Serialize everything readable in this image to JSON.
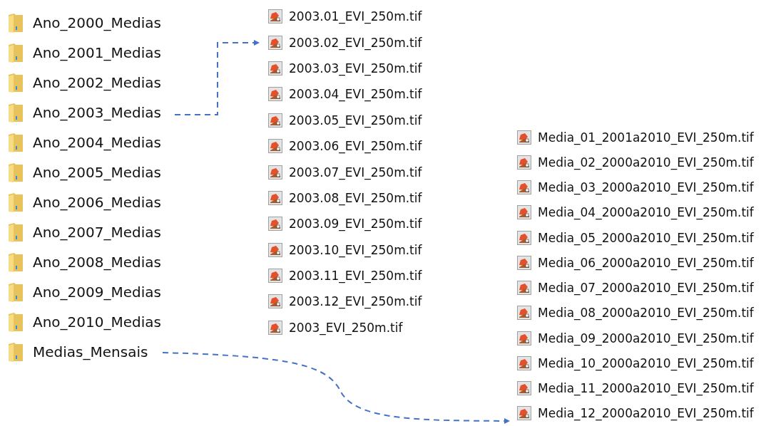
{
  "folders": [
    {
      "name": "Ano_2000_Medias"
    },
    {
      "name": "Ano_2001_Medias"
    },
    {
      "name": "Ano_2002_Medias"
    },
    {
      "name": "Ano_2003_Medias"
    },
    {
      "name": "Ano_2004_Medias"
    },
    {
      "name": "Ano_2005_Medias"
    },
    {
      "name": "Ano_2006_Medias"
    },
    {
      "name": "Ano_2007_Medias"
    },
    {
      "name": "Ano_2008_Medias"
    },
    {
      "name": "Ano_2009_Medias"
    },
    {
      "name": "Ano_2010_Medias"
    },
    {
      "name": "Medias_Mensais"
    }
  ],
  "year_files": [
    {
      "name": "2003.01_EVI_250m.tif"
    },
    {
      "name": "2003.02_EVI_250m.tif"
    },
    {
      "name": "2003.03_EVI_250m.tif"
    },
    {
      "name": "2003.04_EVI_250m.tif"
    },
    {
      "name": "2003.05_EVI_250m.tif"
    },
    {
      "name": "2003.06_EVI_250m.tif"
    },
    {
      "name": "2003.07_EVI_250m.tif"
    },
    {
      "name": "2003.08_EVI_250m.tif"
    },
    {
      "name": "2003.09_EVI_250m.tif"
    },
    {
      "name": "2003.10_EVI_250m.tif"
    },
    {
      "name": "2003.11_EVI_250m.tif"
    },
    {
      "name": "2003.12_EVI_250m.tif"
    },
    {
      "name": "2003_EVI_250m.tif"
    }
  ],
  "monthly_files": [
    {
      "name": "Media_01_2001a2010_EVI_250m.tif"
    },
    {
      "name": "Media_02_2000a2010_EVI_250m.tif"
    },
    {
      "name": "Media_03_2000a2010_EVI_250m.tif"
    },
    {
      "name": "Media_04_2000a2010_EVI_250m.tif"
    },
    {
      "name": "Media_05_2000a2010_EVI_250m.tif"
    },
    {
      "name": "Media_06_2000a2010_EVI_250m.tif"
    },
    {
      "name": "Media_07_2000a2010_EVI_250m.tif"
    },
    {
      "name": "Media_08_2000a2010_EVI_250m.tif"
    },
    {
      "name": "Media_09_2000a2010_EVI_250m.tif"
    },
    {
      "name": "Media_10_2000a2010_EVI_250m.tif"
    },
    {
      "name": "Media_11_2000a2010_EVI_250m.tif"
    },
    {
      "name": "Media_12_2000a2010_EVI_250m.tif"
    }
  ]
}
